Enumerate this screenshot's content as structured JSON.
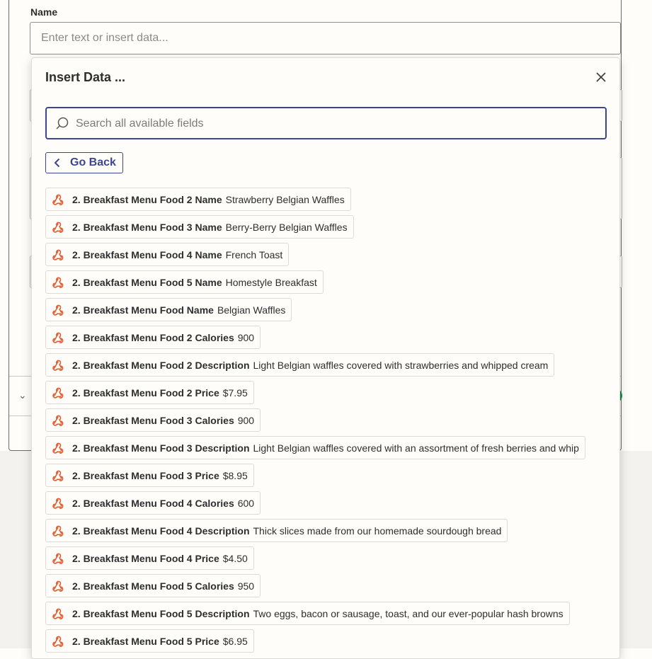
{
  "form": {
    "name_label": "Name",
    "name_placeholder": "Enter text or insert data..."
  },
  "modal": {
    "title": "Insert Data ...",
    "search_placeholder": "Search all available fields",
    "back_label": "Go Back",
    "items": [
      {
        "key": "2. Breakfast Menu Food 2 Name",
        "value": "Strawberry Belgian Waffles"
      },
      {
        "key": "2. Breakfast Menu Food 3 Name",
        "value": "Berry-Berry Belgian Waffles"
      },
      {
        "key": "2. Breakfast Menu Food 4 Name",
        "value": "French Toast"
      },
      {
        "key": "2. Breakfast Menu Food 5 Name",
        "value": "Homestyle Breakfast"
      },
      {
        "key": "2. Breakfast Menu Food Name",
        "value": "Belgian Waffles"
      },
      {
        "key": "2. Breakfast Menu Food 2 Calories",
        "value": "900"
      },
      {
        "key": "2. Breakfast Menu Food 2 Description",
        "value": "Light Belgian waffles covered with strawberries and whipped cream"
      },
      {
        "key": "2. Breakfast Menu Food 2 Price",
        "value": "$7.95"
      },
      {
        "key": "2. Breakfast Menu Food 3 Calories",
        "value": "900"
      },
      {
        "key": "2. Breakfast Menu Food 3 Description",
        "value": "Light Belgian waffles covered with an assortment of fresh berries and whip"
      },
      {
        "key": "2. Breakfast Menu Food 3 Price",
        "value": "$8.95"
      },
      {
        "key": "2. Breakfast Menu Food 4 Calories",
        "value": "600"
      },
      {
        "key": "2. Breakfast Menu Food 4 Description",
        "value": "Thick slices made from our homemade sourdough bread"
      },
      {
        "key": "2. Breakfast Menu Food 4 Price",
        "value": "$4.50"
      },
      {
        "key": "2. Breakfast Menu Food 5 Calories",
        "value": "950"
      },
      {
        "key": "2. Breakfast Menu Food 5 Description",
        "value": "Two eggs, bacon or sausage, toast, and our ever-popular hash browns"
      },
      {
        "key": "2. Breakfast Menu Food 5 Price",
        "value": "$6.95"
      }
    ]
  },
  "colors": {
    "accent": "#3d4592",
    "webhook_icon": "#e5582b",
    "background": "#fffdf9"
  },
  "icons": {
    "item": "webhook-icon",
    "search": "search-icon",
    "close": "close-icon",
    "back": "chevron-left-icon"
  }
}
